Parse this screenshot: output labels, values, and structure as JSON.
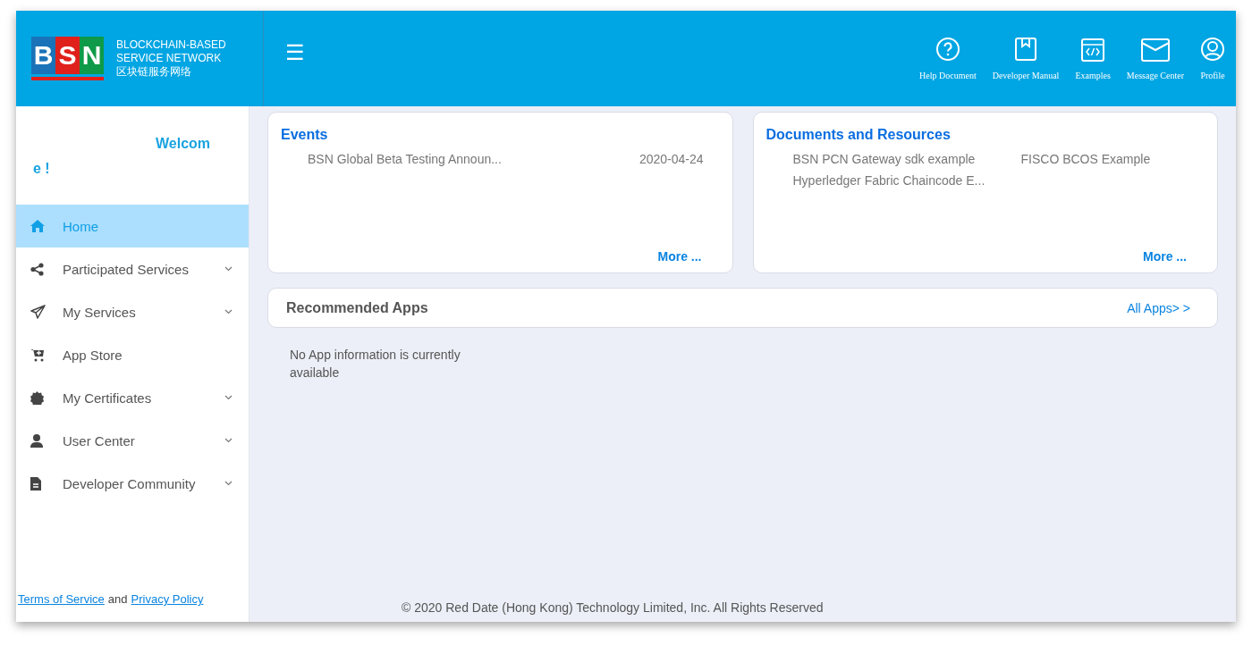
{
  "logo": {
    "letters": [
      "B",
      "S",
      "N"
    ],
    "line1": "BLOCKCHAIN-BASED",
    "line2": "SERVICE NETWORK",
    "line3": "区块链服务网络"
  },
  "menu_toggle": "☰",
  "header_nav": [
    {
      "label": "Help Document"
    },
    {
      "label": "Developer Manual"
    },
    {
      "label": "Examples"
    },
    {
      "label": "Message Center"
    },
    {
      "label": "Profile"
    }
  ],
  "sidebar": {
    "welcome": "Welcome !",
    "items": [
      {
        "label": "Home",
        "selected": true,
        "has_submenu": false
      },
      {
        "label": "Participated Services",
        "selected": false,
        "has_submenu": true
      },
      {
        "label": "My Services",
        "selected": false,
        "has_submenu": true
      },
      {
        "label": "App Store",
        "selected": false,
        "has_submenu": false
      },
      {
        "label": "My Certificates",
        "selected": false,
        "has_submenu": true
      },
      {
        "label": "User Center",
        "selected": false,
        "has_submenu": true
      },
      {
        "label": "Developer Community",
        "selected": false,
        "has_submenu": true
      }
    ],
    "terms": "Terms of Service",
    "and": "and",
    "privacy": "Privacy Policy"
  },
  "events": {
    "title": "Events",
    "items": [
      {
        "title": "BSN Global Beta Testing Announ...",
        "date": "2020-04-24"
      }
    ],
    "more": "More ..."
  },
  "documents": {
    "title": "Documents and Resources",
    "items": [
      "BSN PCN Gateway sdk example",
      "FISCO BCOS Example",
      "Hyperledger Fabric Chaincode E..."
    ],
    "more": "More ..."
  },
  "recommended": {
    "title": "Recommended Apps",
    "all": "All Apps> >",
    "empty": "No App information is currently available"
  },
  "footer": "© 2020 Red Date (Hong Kong) Technology Limited, Inc. All Rights Reserved"
}
